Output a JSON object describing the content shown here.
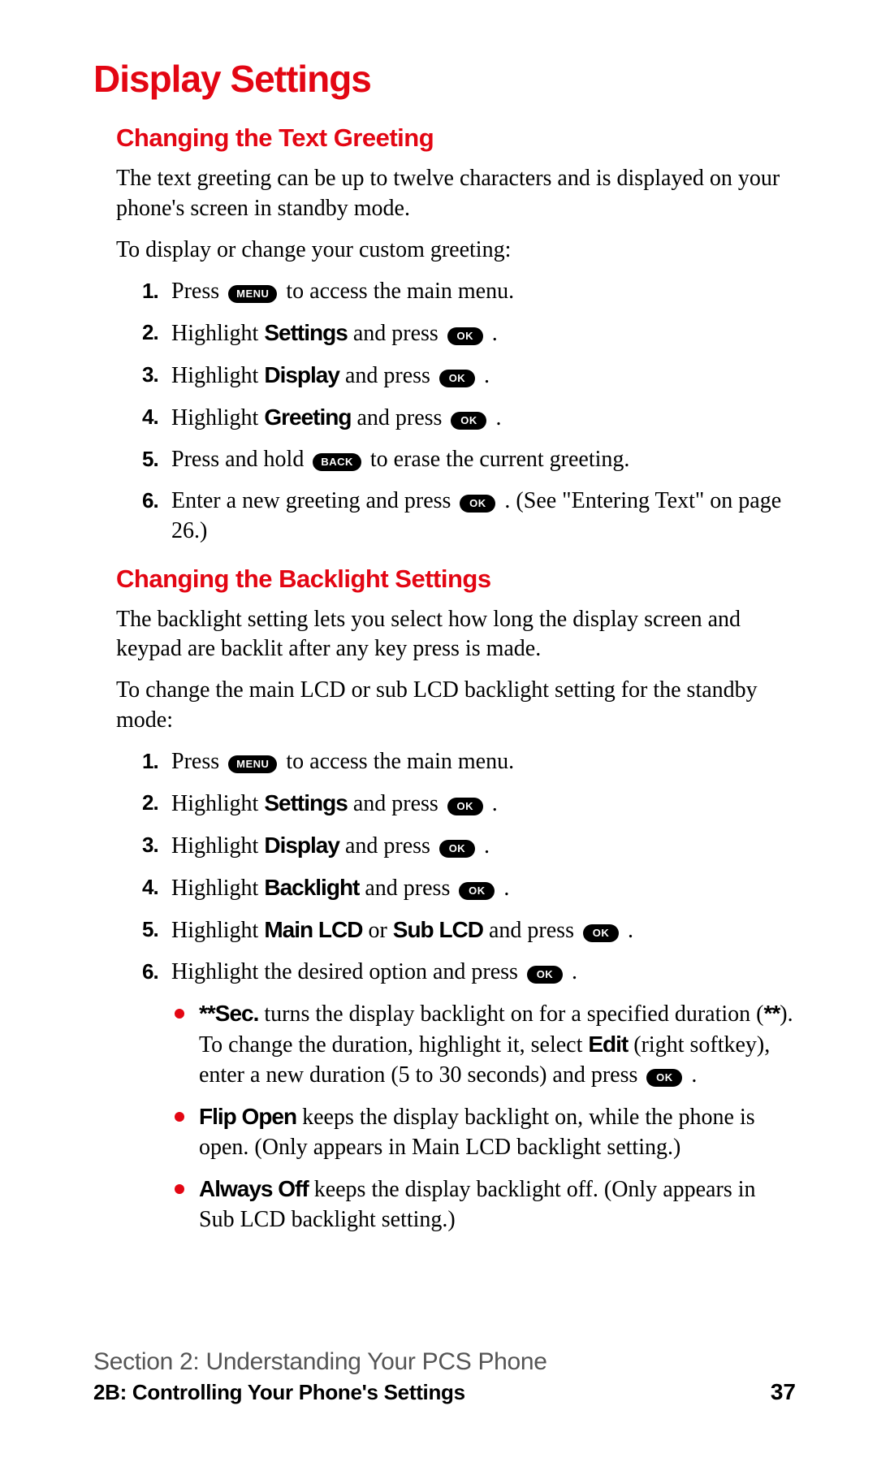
{
  "title": "Display Settings",
  "section1": {
    "heading": "Changing the Text Greeting",
    "intro": "The text greeting can be up to twelve characters and is displayed on your phone's screen in standby mode.",
    "lead": "To display or change your custom greeting:",
    "steps": {
      "s1a": "Press ",
      "s1b": " to access the main menu.",
      "s2a": "Highlight ",
      "s2b": "Settings",
      "s2c": " and press ",
      "s2d": " .",
      "s3a": "Highlight ",
      "s3b": "Display",
      "s3c": " and press ",
      "s3d": " .",
      "s4a": "Highlight ",
      "s4b": "Greeting",
      "s4c": " and press ",
      "s4d": " .",
      "s5a": "Press and hold ",
      "s5b": " to erase the current greeting.",
      "s6a": "Enter a new greeting and press ",
      "s6b": " . (See \"Entering Text\" on page 26.)"
    }
  },
  "section2": {
    "heading": "Changing the Backlight Settings",
    "intro": "The backlight setting lets you select how long the display screen and keypad are backlit after any key press is made.",
    "lead": "To change the main LCD or sub LCD backlight setting for the standby mode:",
    "steps": {
      "s1a": "Press ",
      "s1b": " to access the main menu.",
      "s2a": "Highlight ",
      "s2b": "Settings",
      "s2c": " and press ",
      "s2d": " .",
      "s3a": "Highlight ",
      "s3b": "Display",
      "s3c": " and press ",
      "s3d": " .",
      "s4a": "Highlight ",
      "s4b": "Backlight",
      "s4c": " and press ",
      "s4d": " .",
      "s5a": "Highlight ",
      "s5b": "Main LCD",
      "s5c": " or ",
      "s5d": "Sub LCD",
      "s5e": " and press ",
      "s5f": " .",
      "s6a": "Highlight the desired option and press ",
      "s6b": " ."
    },
    "bullets": {
      "b1a": "**Sec.",
      "b1b": " turns the display backlight on for a specified duration (",
      "b1c": "**",
      "b1d": "). To change the duration, highlight it, select ",
      "b1e": "Edit",
      "b1f": " (right softkey), enter a new duration (5 to 30 seconds) and press ",
      "b1g": " .",
      "b2a": "Flip Open",
      "b2b": " keeps the display backlight on, while the phone is open. (Only appears in Main LCD backlight setting.)",
      "b3a": "Always Off",
      "b3b": " keeps the display backlight off. (Only appears in Sub LCD backlight setting.)"
    }
  },
  "buttons": {
    "menu": "MENU",
    "ok": "OK",
    "back": "BACK"
  },
  "footer": {
    "section": "Section 2: Understanding Your PCS Phone",
    "chapter": "2B: Controlling Your Phone's Settings",
    "page": "37"
  }
}
